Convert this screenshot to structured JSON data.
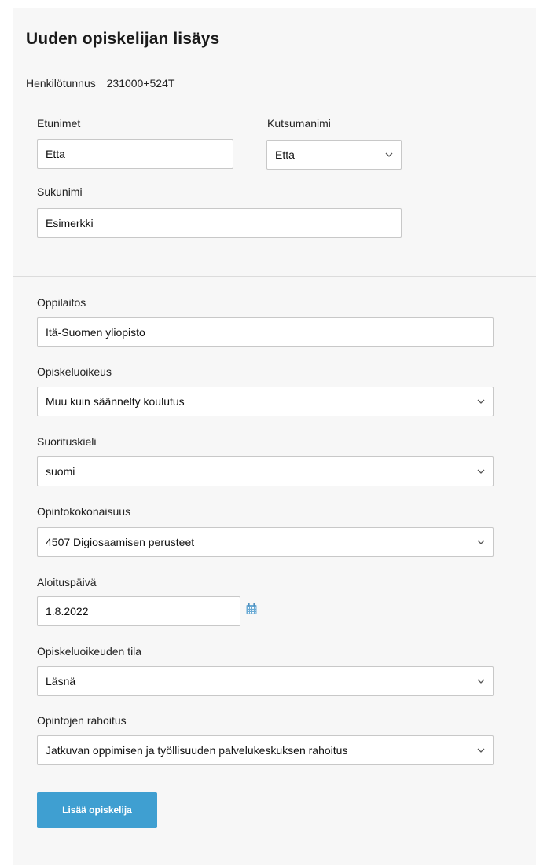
{
  "title": "Uuden opiskelijan lisäys",
  "hetu": {
    "label": "Henkilötunnus",
    "value": "231000+524T"
  },
  "fields": {
    "etunimet": {
      "label": "Etunimet",
      "value": "Etta"
    },
    "kutsumanimi": {
      "label": "Kutsumanimi",
      "value": "Etta"
    },
    "sukunimi": {
      "label": "Sukunimi",
      "value": "Esimerkki"
    },
    "oppilaitos": {
      "label": "Oppilaitos",
      "value": "Itä-Suomen yliopisto"
    },
    "opiskeluoikeus": {
      "label": "Opiskeluoikeus",
      "value": "Muu kuin säännelty koulutus"
    },
    "suorituskieli": {
      "label": "Suorituskieli",
      "value": "suomi"
    },
    "opintokokonaisuus": {
      "label": "Opintokokonaisuus",
      "value": "4507 Digiosaamisen perusteet"
    },
    "aloituspaiva": {
      "label": "Aloituspäivä",
      "value": "1.8.2022"
    },
    "tila": {
      "label": "Opiskeluoikeuden tila",
      "value": "Läsnä"
    },
    "rahoitus": {
      "label": "Opintojen rahoitus",
      "value": "Jatkuvan oppimisen ja työllisuuden palvelukeskuksen rahoitus"
    }
  },
  "submit_label": "Lisää opiskelija",
  "colors": {
    "accent": "#3f9fd1",
    "panel_bg": "#f7f7f7",
    "border": "#c8c8c8"
  },
  "icons": {
    "dropdown": "chevron-down-icon",
    "date": "calendar-icon"
  }
}
